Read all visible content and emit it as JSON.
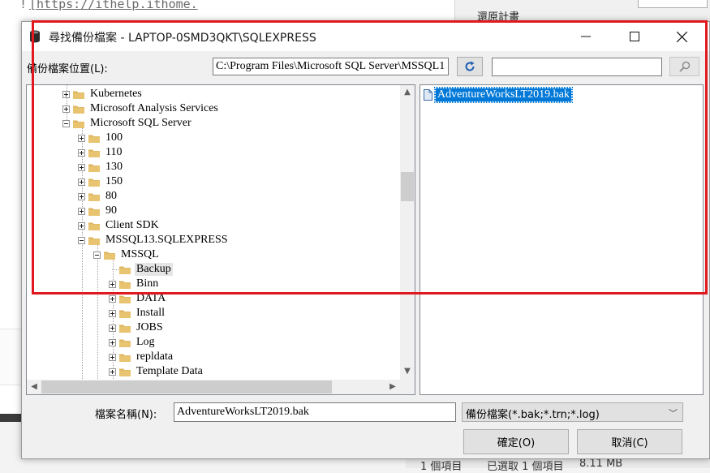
{
  "background": {
    "editor_url_prefix": "!",
    "editor_url": "[https://ithelp.ithome.",
    "right_panel_text": "還原計畫",
    "status_items": [
      "1 個項目",
      "已選取 1 個項目",
      "8.11 MB"
    ]
  },
  "dialog": {
    "title": "尋找備份檔案 - LAPTOP-0SMD3QKT\\SQLEXPRESS",
    "location_label": "備份檔案位置(L):",
    "path_value": "C:\\Program Files\\Microsoft SQL Server\\MSSQL1",
    "search_value": "",
    "tree": [
      {
        "label": "Kubernetes",
        "level": 0,
        "expander": "plus"
      },
      {
        "label": "Microsoft Analysis Services",
        "level": 0,
        "expander": "plus"
      },
      {
        "label": "Microsoft SQL Server",
        "level": 0,
        "expander": "minus"
      },
      {
        "label": "100",
        "level": 1,
        "expander": "plus"
      },
      {
        "label": "110",
        "level": 1,
        "expander": "plus"
      },
      {
        "label": "130",
        "level": 1,
        "expander": "plus"
      },
      {
        "label": "150",
        "level": 1,
        "expander": "plus"
      },
      {
        "label": "80",
        "level": 1,
        "expander": "plus"
      },
      {
        "label": "90",
        "level": 1,
        "expander": "plus"
      },
      {
        "label": "Client SDK",
        "level": 1,
        "expander": "plus"
      },
      {
        "label": "MSSQL13.SQLEXPRESS",
        "level": 1,
        "expander": "minus"
      },
      {
        "label": "MSSQL",
        "level": 2,
        "expander": "minus"
      },
      {
        "label": "Backup",
        "level": 3,
        "expander": "none",
        "selected": true
      },
      {
        "label": "Binn",
        "level": 3,
        "expander": "plus"
      },
      {
        "label": "DATA",
        "level": 3,
        "expander": "plus"
      },
      {
        "label": "Install",
        "level": 3,
        "expander": "plus"
      },
      {
        "label": "JOBS",
        "level": 3,
        "expander": "plus"
      },
      {
        "label": "Log",
        "level": 3,
        "expander": "plus"
      },
      {
        "label": "repldata",
        "level": 3,
        "expander": "plus"
      },
      {
        "label": "Template Data",
        "level": 3,
        "expander": "plus"
      }
    ],
    "files": [
      {
        "label": "AdventureWorksLT2019.bak",
        "selected": true
      }
    ],
    "filename_label": "檔案名稱(N):",
    "filename_value": "AdventureWorksLT2019.bak",
    "filter_value": "備份檔案(*.bak;*.trn;*.log)",
    "ok_label": "確定(O)",
    "cancel_label": "取消(C)"
  },
  "colors": {
    "highlight": "#e0191f",
    "selection": "#0078d7",
    "folder": "#dcb35c"
  }
}
